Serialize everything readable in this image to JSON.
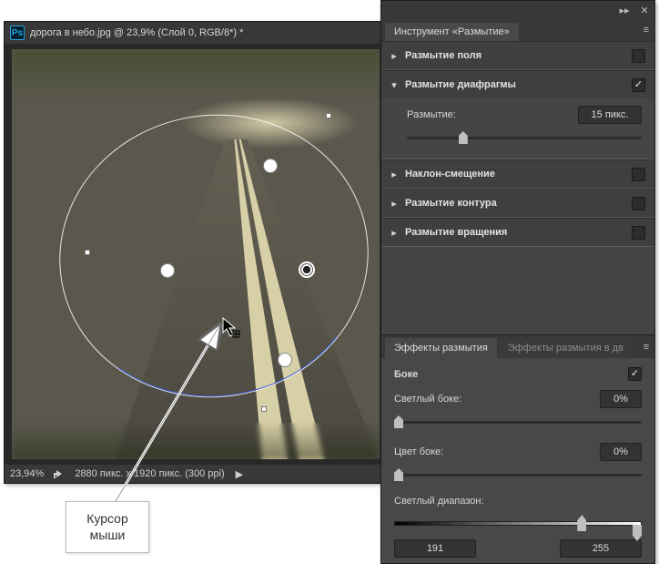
{
  "doc": {
    "title": "дорога в небо.jpg @ 23,9% (Слой 0, RGB/8*) *",
    "zoom": "23,94%",
    "dimensions": "2880 пикс. x 1920 пикс. (300 ppi)"
  },
  "panel": {
    "title": "Инструмент «Размытие»",
    "sections": {
      "field": {
        "label": "Размытие поля",
        "expanded": false,
        "enabled": false
      },
      "iris": {
        "label": "Размытие диафрагмы",
        "expanded": true,
        "enabled": true,
        "slider_label": "Размытие:",
        "value": "15 пикс."
      },
      "tilt": {
        "label": "Наклон-смещение",
        "expanded": false,
        "enabled": false
      },
      "path": {
        "label": "Размытие контура",
        "expanded": false,
        "enabled": false
      },
      "spin": {
        "label": "Размытие вращения",
        "expanded": false,
        "enabled": false
      }
    }
  },
  "effects": {
    "tab_active": "Эффекты размытия",
    "tab_inactive": "Эффекты размытия в дв",
    "bokeh_label": "Боке",
    "bokeh_enabled": true,
    "light_label": "Светлый боке:",
    "light_value": "0%",
    "color_label": "Цвет боке:",
    "color_value": "0%",
    "range_label": "Светлый диапазон:",
    "range_min": "191",
    "range_max": "255"
  },
  "callout": {
    "line1": "Курсор",
    "line2": "мыши"
  }
}
